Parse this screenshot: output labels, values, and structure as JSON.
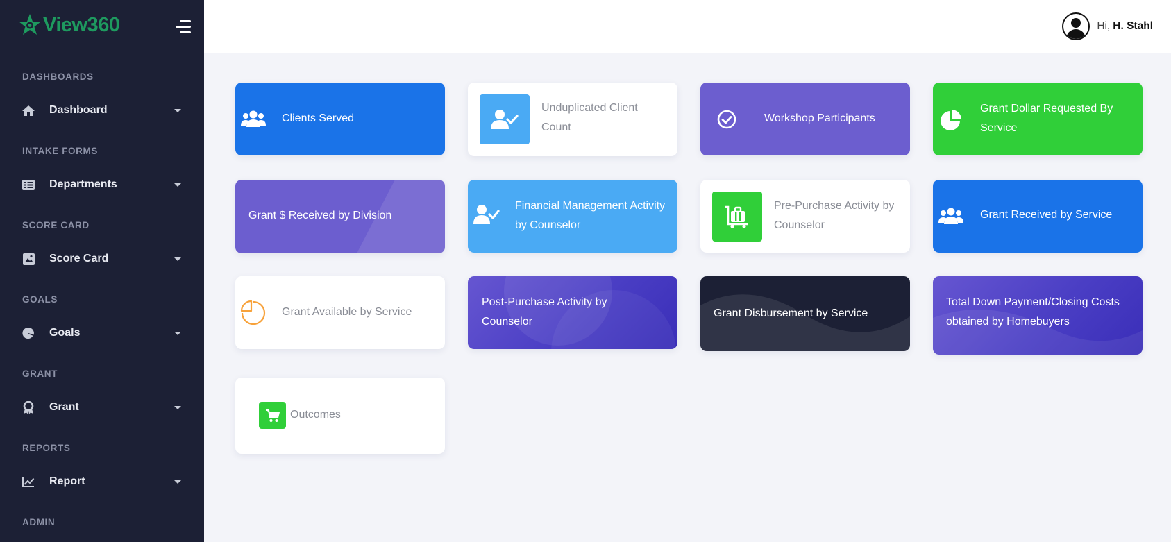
{
  "brand": {
    "name": "View360",
    "logo_icon": "star-logo-icon",
    "menu_icon": "hamburger-menu-icon"
  },
  "header": {
    "greeting": "Hi,",
    "user_name": "H. Stahl",
    "avatar_icon": "user-avatar-icon"
  },
  "sidebar": {
    "sections": [
      {
        "title": "DASHBOARDS",
        "item": {
          "label": "Dashboard",
          "icon": "home-icon"
        }
      },
      {
        "title": "INTAKE FORMS",
        "item": {
          "label": "Departments",
          "icon": "list-icon"
        }
      },
      {
        "title": "SCORE CARD",
        "item": {
          "label": "Score Card",
          "icon": "image-icon"
        }
      },
      {
        "title": "GOALS",
        "item": {
          "label": "Goals",
          "icon": "pie-chart-icon"
        }
      },
      {
        "title": "GRANT",
        "item": {
          "label": "Grant",
          "icon": "award-icon"
        }
      },
      {
        "title": "REPORTS",
        "item": {
          "label": "Report",
          "icon": "line-chart-icon"
        }
      },
      {
        "title": "ADMIN"
      }
    ]
  },
  "cards": [
    {
      "label": "Clients Served",
      "icon": "users-icon",
      "bg": "#1a73e8"
    },
    {
      "label": "Unduplicated Client Count",
      "icon": "user-check-icon",
      "bg": "#ffffff",
      "icon_bg": "#4aaaf4"
    },
    {
      "label": "Workshop Participants",
      "icon": "check-circle-icon",
      "bg": "#6c5ecf"
    },
    {
      "label": "Grant Dollar Requested By Service",
      "icon": "pie-chart-icon",
      "bg": "#30cf39"
    },
    {
      "label": "Grant $ Received by Division",
      "bg": "#6c5ecf"
    },
    {
      "label": "Financial Management Activity by Counselor",
      "icon": "user-check-icon",
      "bg": "#4aaaf4"
    },
    {
      "label": "Pre-Purchase Activity by Counselor",
      "icon": "luggage-cart-icon",
      "bg": "#ffffff",
      "icon_bg": "#30cf39"
    },
    {
      "label": "Grant Received by Service",
      "icon": "users-icon",
      "bg": "#1a73e8"
    },
    {
      "label": "Grant Available by Service",
      "icon": "pie-chart-outline-icon",
      "bg": "#ffffff",
      "icon_color": "#f7a23b"
    },
    {
      "label": "Post-Purchase Activity by Counselor",
      "bg": "#5042c7"
    },
    {
      "label": "Grant Disbursement by Service",
      "bg": "#1c2035"
    },
    {
      "label": "Total Down Payment/Closing Costs obtained by Homebuyers",
      "bg": "#5042c7"
    },
    {
      "label": "Outcomes",
      "icon": "shopping-cart-icon",
      "bg": "#ffffff",
      "icon_bg": "#30cf39"
    }
  ]
}
